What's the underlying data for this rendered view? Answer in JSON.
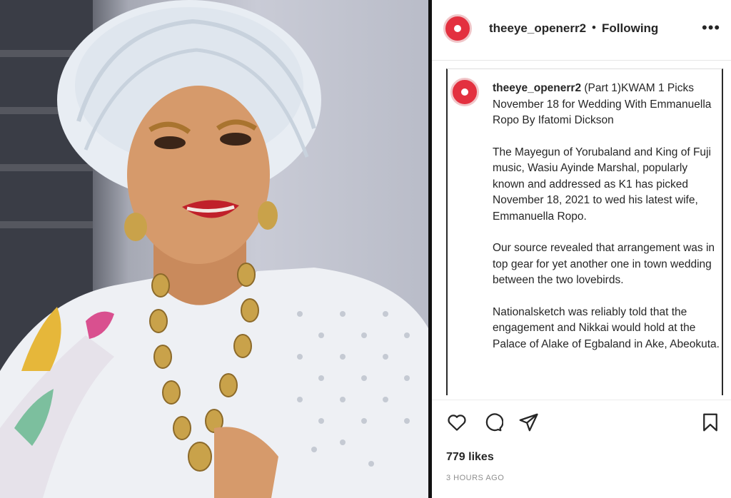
{
  "post": {
    "username": "theeye_openerr2",
    "separator": "•",
    "follow_status": "Following",
    "more_label": "•••",
    "caption_title": "(Part 1)KWAM 1 Picks November 18 for Wedding With Emmanuella Ropo By Ifatomi Dickson",
    "caption_paragraphs": [
      "The Mayegun of Yorubaland and King of Fuji music, Wasiu Ayinde Marshal, popularly known and addressed as K1 has picked November 18, 2021 to wed his latest wife, Emmanuella Ropo.",
      "Our source revealed that arrangement was in top gear for yet another one in town wedding between the two lovebirds.",
      "Nationalsketch was reliably told that the engagement and Nikkai would hold at the Palace of Alake of Egbaland in Ake, Abeokuta."
    ],
    "likes": "779 likes",
    "time_ago": "3 HOURS AGO"
  },
  "icons": {
    "like": "heart-icon",
    "comment": "comment-icon",
    "share": "send-icon",
    "save": "bookmark-icon",
    "more": "more-icon"
  },
  "colors": {
    "avatar_red": "#e3303f",
    "text": "#262626",
    "muted": "#8e8e8e"
  }
}
